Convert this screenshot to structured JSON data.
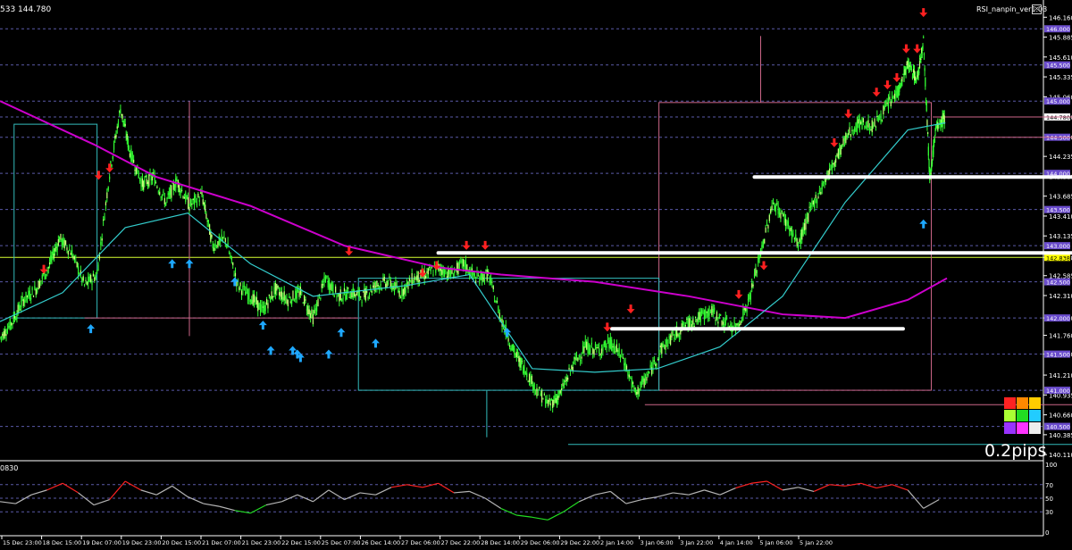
{
  "header": {
    "symbol_price": "533 144.780",
    "indicator": "RSI_nanpin_ver1.03",
    "rsi_label": "0830",
    "spread": "0.2pips"
  },
  "chart_data": {
    "type": "candlestick",
    "title": "",
    "y_axis_ticks": [
      "146.160",
      "145.885",
      "145.610",
      "145.335",
      "145.060",
      "144.780",
      "144.500",
      "144.235",
      "143.960",
      "143.685",
      "143.410",
      "143.135",
      "142.838",
      "142.585",
      "142.310",
      "142.000",
      "141.760",
      "141.500",
      "141.210",
      "140.935",
      "140.660",
      "140.385",
      "140.110"
    ],
    "highlighted_levels": [
      {
        "label": "146.000",
        "value": 146.0
      },
      {
        "label": "145.500",
        "value": 145.5
      },
      {
        "label": "145.000",
        "value": 145.0
      },
      {
        "label": "144.780",
        "value": 144.78
      },
      {
        "label": "144.500",
        "value": 144.5
      },
      {
        "label": "144.000",
        "value": 144.0
      },
      {
        "label": "143.500",
        "value": 143.5
      },
      {
        "label": "143.000",
        "value": 143.0
      },
      {
        "label": "142.838",
        "value": 142.838
      },
      {
        "label": "142.500",
        "value": 142.5
      },
      {
        "label": "142.000",
        "value": 142.0
      },
      {
        "label": "141.500",
        "value": 141.5
      },
      {
        "label": "141.000",
        "value": 141.0
      },
      {
        "label": "140.500",
        "value": 140.5
      }
    ],
    "current_price": 144.78,
    "ylim": [
      140.05,
      146.25
    ],
    "x_tick_labels": [
      "15 Dec 23:00",
      "18 Dec 15:00",
      "19 Dec 07:00",
      "19 Dec 23:00",
      "20 Dec 15:00",
      "21 Dec 07:00",
      "21 Dec 23:00",
      "22 Dec 15:00",
      "25 Dec 07:00",
      "26 Dec 14:00",
      "27 Dec 06:00",
      "27 Dec 22:00",
      "28 Dec 14:00",
      "29 Dec 06:00",
      "29 Dec 22:00",
      "2 Jan 14:00",
      "3 Jan 06:00",
      "3 Jan 22:00",
      "4 Jan 14:00",
      "5 Jan 06:00",
      "5 Jan 22:00"
    ],
    "price_path": [
      [
        0,
        141.72
      ],
      [
        0.8,
        141.95
      ],
      [
        1.5,
        142.25
      ],
      [
        2.3,
        142.4
      ],
      [
        3.1,
        142.7
      ],
      [
        3.8,
        143.1
      ],
      [
        4.6,
        142.9
      ],
      [
        5.4,
        142.45
      ],
      [
        6.2,
        142.6
      ],
      [
        7.0,
        144.0
      ],
      [
        7.7,
        144.9
      ],
      [
        8.3,
        144.3
      ],
      [
        9.1,
        143.85
      ],
      [
        9.8,
        143.95
      ],
      [
        10.6,
        143.6
      ],
      [
        11.3,
        143.9
      ],
      [
        12.1,
        143.55
      ],
      [
        12.9,
        143.7
      ],
      [
        13.6,
        143.0
      ],
      [
        14.4,
        143.1
      ],
      [
        15.2,
        142.45
      ],
      [
        16.0,
        142.3
      ],
      [
        16.8,
        142.1
      ],
      [
        17.6,
        142.4
      ],
      [
        18.4,
        142.25
      ],
      [
        19.2,
        142.35
      ],
      [
        20.0,
        142.0
      ],
      [
        20.8,
        142.55
      ],
      [
        21.6,
        142.3
      ],
      [
        22.4,
        142.35
      ],
      [
        23.2,
        142.3
      ],
      [
        24.0,
        142.45
      ],
      [
        24.8,
        142.5
      ],
      [
        25.6,
        142.35
      ],
      [
        26.4,
        142.55
      ],
      [
        27.2,
        142.6
      ],
      [
        28.0,
        142.7
      ],
      [
        28.8,
        142.6
      ],
      [
        29.6,
        142.75
      ],
      [
        30.4,
        142.55
      ],
      [
        31.2,
        142.6
      ],
      [
        32.0,
        142.0
      ],
      [
        32.8,
        141.55
      ],
      [
        33.5,
        141.3
      ],
      [
        34.3,
        141.0
      ],
      [
        35.1,
        140.8
      ],
      [
        35.8,
        140.95
      ],
      [
        36.6,
        141.35
      ],
      [
        37.4,
        141.6
      ],
      [
        38.2,
        141.55
      ],
      [
        39.0,
        141.65
      ],
      [
        39.8,
        141.45
      ],
      [
        40.6,
        140.95
      ],
      [
        41.4,
        141.2
      ],
      [
        42.2,
        141.55
      ],
      [
        43.0,
        141.75
      ],
      [
        43.8,
        141.9
      ],
      [
        44.6,
        142.0
      ],
      [
        45.4,
        142.1
      ],
      [
        46.2,
        141.95
      ],
      [
        47.0,
        141.85
      ],
      [
        47.8,
        142.2
      ],
      [
        48.6,
        142.9
      ],
      [
        49.4,
        143.6
      ],
      [
        50.2,
        143.35
      ],
      [
        51.0,
        143.0
      ],
      [
        51.8,
        143.5
      ],
      [
        52.6,
        143.85
      ],
      [
        53.4,
        144.2
      ],
      [
        54.2,
        144.55
      ],
      [
        55.0,
        144.7
      ],
      [
        55.8,
        144.65
      ],
      [
        56.6,
        144.9
      ],
      [
        57.4,
        145.15
      ],
      [
        58.0,
        145.5
      ],
      [
        58.6,
        145.3
      ],
      [
        59.0,
        145.85
      ],
      [
        59.4,
        143.95
      ],
      [
        59.8,
        144.6
      ],
      [
        60.4,
        144.78
      ]
    ],
    "overlays": {
      "ma_magenta": [
        [
          0,
          145.0
        ],
        [
          6,
          144.4
        ],
        [
          10,
          143.95
        ],
        [
          16,
          143.55
        ],
        [
          22,
          143.0
        ],
        [
          28,
          142.7
        ],
        [
          32,
          142.6
        ],
        [
          38,
          142.5
        ],
        [
          44,
          142.3
        ],
        [
          50,
          142.05
        ],
        [
          54,
          142.0
        ],
        [
          58,
          142.25
        ],
        [
          60.5,
          142.55
        ]
      ],
      "ma_cyan": [
        [
          0,
          141.95
        ],
        [
          4,
          142.35
        ],
        [
          8,
          143.25
        ],
        [
          12,
          143.45
        ],
        [
          16,
          142.75
        ],
        [
          20,
          142.3
        ],
        [
          26,
          142.45
        ],
        [
          30,
          142.6
        ],
        [
          34,
          141.3
        ],
        [
          38,
          141.25
        ],
        [
          42,
          141.3
        ],
        [
          46,
          141.6
        ],
        [
          50,
          142.3
        ],
        [
          54,
          143.6
        ],
        [
          58,
          144.6
        ],
        [
          60.4,
          144.7
        ]
      ]
    },
    "horizontal_white_lines": [
      {
        "x_from": 28.0,
        "x_to": 72.0,
        "y": 142.9
      },
      {
        "x_from": 48.2,
        "x_to": 72.0,
        "y": 143.95
      },
      {
        "x_from": 39.1,
        "x_to": 57.7,
        "y": 141.85
      }
    ],
    "down_arrows": [
      [
        2.8,
        142.55
      ],
      [
        6.3,
        143.85
      ],
      [
        7.0,
        143.95
      ],
      [
        22.3,
        142.8
      ],
      [
        27.0,
        142.5
      ],
      [
        27.9,
        142.6
      ],
      [
        29.8,
        142.88
      ],
      [
        31.0,
        142.88
      ],
      [
        38.8,
        141.75
      ],
      [
        40.3,
        142.0
      ],
      [
        47.2,
        142.2
      ],
      [
        48.8,
        142.6
      ],
      [
        53.3,
        144.3
      ],
      [
        54.2,
        144.7
      ],
      [
        56.0,
        145.0
      ],
      [
        56.7,
        145.1
      ],
      [
        57.3,
        145.2
      ],
      [
        57.9,
        145.6
      ],
      [
        58.6,
        145.6
      ],
      [
        59.0,
        146.1
      ]
    ],
    "up_arrows": [
      [
        5.8,
        141.95
      ],
      [
        11.0,
        142.85
      ],
      [
        12.1,
        142.85
      ],
      [
        15.0,
        142.6
      ],
      [
        16.8,
        142.0
      ],
      [
        17.3,
        141.65
      ],
      [
        18.7,
        141.65
      ],
      [
        19.0,
        141.6
      ],
      [
        19.2,
        141.55
      ],
      [
        21.0,
        141.6
      ],
      [
        21.8,
        141.9
      ],
      [
        24.0,
        141.75
      ],
      [
        32.4,
        141.9
      ],
      [
        59.0,
        143.4
      ]
    ],
    "rsi": {
      "levels": [
        "70",
        "50",
        "30"
      ],
      "tick_labels": [
        "100",
        "70",
        "50",
        "30",
        "0"
      ],
      "values": [
        [
          0,
          45
        ],
        [
          1,
          42
        ],
        [
          2,
          55
        ],
        [
          3,
          62
        ],
        [
          4,
          72
        ],
        [
          5,
          58
        ],
        [
          6,
          40
        ],
        [
          7,
          48
        ],
        [
          8,
          75
        ],
        [
          9,
          62
        ],
        [
          10,
          55
        ],
        [
          11,
          68
        ],
        [
          12,
          52
        ],
        [
          13,
          42
        ],
        [
          14,
          38
        ],
        [
          15,
          32
        ],
        [
          16,
          28
        ],
        [
          17,
          40
        ],
        [
          18,
          45
        ],
        [
          19,
          55
        ],
        [
          20,
          45
        ],
        [
          21,
          62
        ],
        [
          22,
          48
        ],
        [
          23,
          58
        ],
        [
          24,
          55
        ],
        [
          25,
          66
        ],
        [
          26,
          70
        ],
        [
          27,
          66
        ],
        [
          28,
          72
        ],
        [
          29,
          58
        ],
        [
          30,
          60
        ],
        [
          31,
          50
        ],
        [
          32,
          35
        ],
        [
          33,
          25
        ],
        [
          34,
          22
        ],
        [
          35,
          18
        ],
        [
          36,
          30
        ],
        [
          37,
          45
        ],
        [
          38,
          55
        ],
        [
          39,
          60
        ],
        [
          40,
          42
        ],
        [
          41,
          48
        ],
        [
          42,
          52
        ],
        [
          43,
          58
        ],
        [
          44,
          55
        ],
        [
          45,
          62
        ],
        [
          46,
          55
        ],
        [
          47,
          65
        ],
        [
          48,
          72
        ],
        [
          49,
          75
        ],
        [
          50,
          62
        ],
        [
          51,
          66
        ],
        [
          52,
          60
        ],
        [
          53,
          70
        ],
        [
          54,
          68
        ],
        [
          55,
          72
        ],
        [
          56,
          65
        ],
        [
          57,
          70
        ],
        [
          58,
          62
        ],
        [
          59,
          35
        ],
        [
          60,
          48
        ]
      ],
      "xlim": [
        0,
        60.5
      ]
    },
    "xlim": [
      0,
      60.5
    ],
    "grid": true,
    "colors": {
      "bull": "#33ff33",
      "bear": "#c8ff7a",
      "magenta": "#cc00cc",
      "cyan": "#33cccc",
      "grid": "#5a5aa8",
      "arrow_down": "#ff2020",
      "arrow_up": "#1ea8ff",
      "rsi": "#b4b4b4"
    }
  }
}
